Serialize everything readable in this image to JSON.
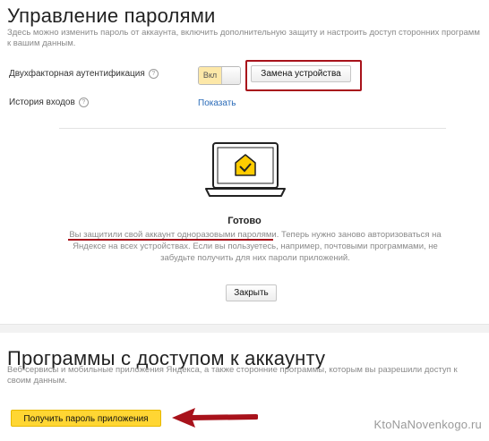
{
  "passwords": {
    "title": "Управление паролями",
    "description": "Здесь можно изменить пароль от аккаунта, включить дополнительную защиту и настроить доступ сторонних программ к вашим данным.",
    "two_factor": {
      "label": "Двухфакторная аутентификация",
      "toggle_label": "Вкл",
      "toggle_state": "on",
      "replace_device_button": "Замена устройства"
    },
    "login_history": {
      "label": "История входов",
      "show_link": "Показать"
    },
    "help_glyph": "?"
  },
  "done_card": {
    "title": "Готово",
    "text": "Вы защитили свой аккаунт одноразовыми паролями. Теперь нужно заново авторизоваться на Яндексе на всех устройствах. Если вы пользуетесь, например, почтовыми программами, не забудьте получить для них пароли приложений.",
    "close_button": "Закрыть"
  },
  "apps": {
    "title": "Программы с доступом к аккаунту",
    "description": "Веб-сервисы и мобильные приложения Яндекса, а также сторонние программы, которым вы разрешили доступ к своим данным.",
    "get_password_button": "Получить пароль приложения"
  },
  "watermark": "KtoNaNovenkogo.ru",
  "colors": {
    "accent_yellow": "#ffd633",
    "annotation_red": "#a8121b",
    "link_blue": "#2a6bb8",
    "check_yellow": "#ffcc00"
  }
}
